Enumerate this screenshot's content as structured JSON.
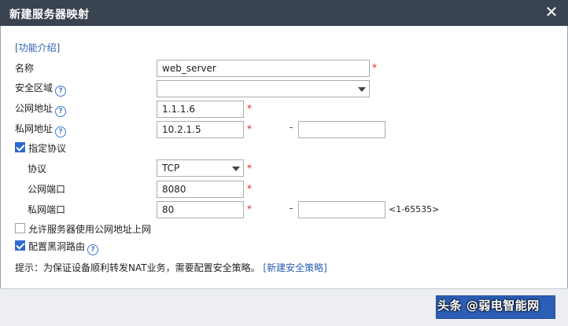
{
  "dialog": {
    "title": "新建服务器映射",
    "close_glyph": "✕",
    "feature_link": "[功能介绍]"
  },
  "form": {
    "name": {
      "label": "名称",
      "value": "web_server",
      "required": "*"
    },
    "security_zone": {
      "label": "安全区域",
      "value": "",
      "help": "?"
    },
    "public_address": {
      "label": "公网地址",
      "value": "1.1.1.6",
      "required": "*",
      "help": "?"
    },
    "private_address": {
      "label": "私网地址",
      "value": "10.2.1.5",
      "end_value": "",
      "required": "*",
      "help": "?",
      "separator": "-"
    },
    "specify_protocol": {
      "label": "指定协议",
      "checked": true
    },
    "protocol": {
      "label": "协议",
      "value": "TCP",
      "required": "*"
    },
    "public_port": {
      "label": "公网端口",
      "value": "8080",
      "required": "*"
    },
    "private_port": {
      "label": "私网端口",
      "value": "80",
      "end_value": "",
      "required": "*",
      "separator": "-",
      "range_hint": "<1-65535>"
    },
    "allow_internet": {
      "label": "允许服务器使用公网地址上网",
      "checked": false
    },
    "blackhole_route": {
      "label": "配置黑洞路由",
      "checked": true,
      "help": "?"
    }
  },
  "hint": {
    "text": "提示：为保证设备顺利转发NAT业务，需要配置安全策略。",
    "link": "[新建安全策略]"
  },
  "footer": {
    "watermark": "头条 @弱电智能网"
  },
  "colors": {
    "titlebar": "#3a4350",
    "link": "#2b5fb3",
    "required": "#e02020",
    "checkbox_checked": "#2d6bd0",
    "footer": "#eceef1"
  },
  "icons": {
    "help": "help-icon",
    "close": "close-icon",
    "dropdown": "chevron-down-icon"
  }
}
